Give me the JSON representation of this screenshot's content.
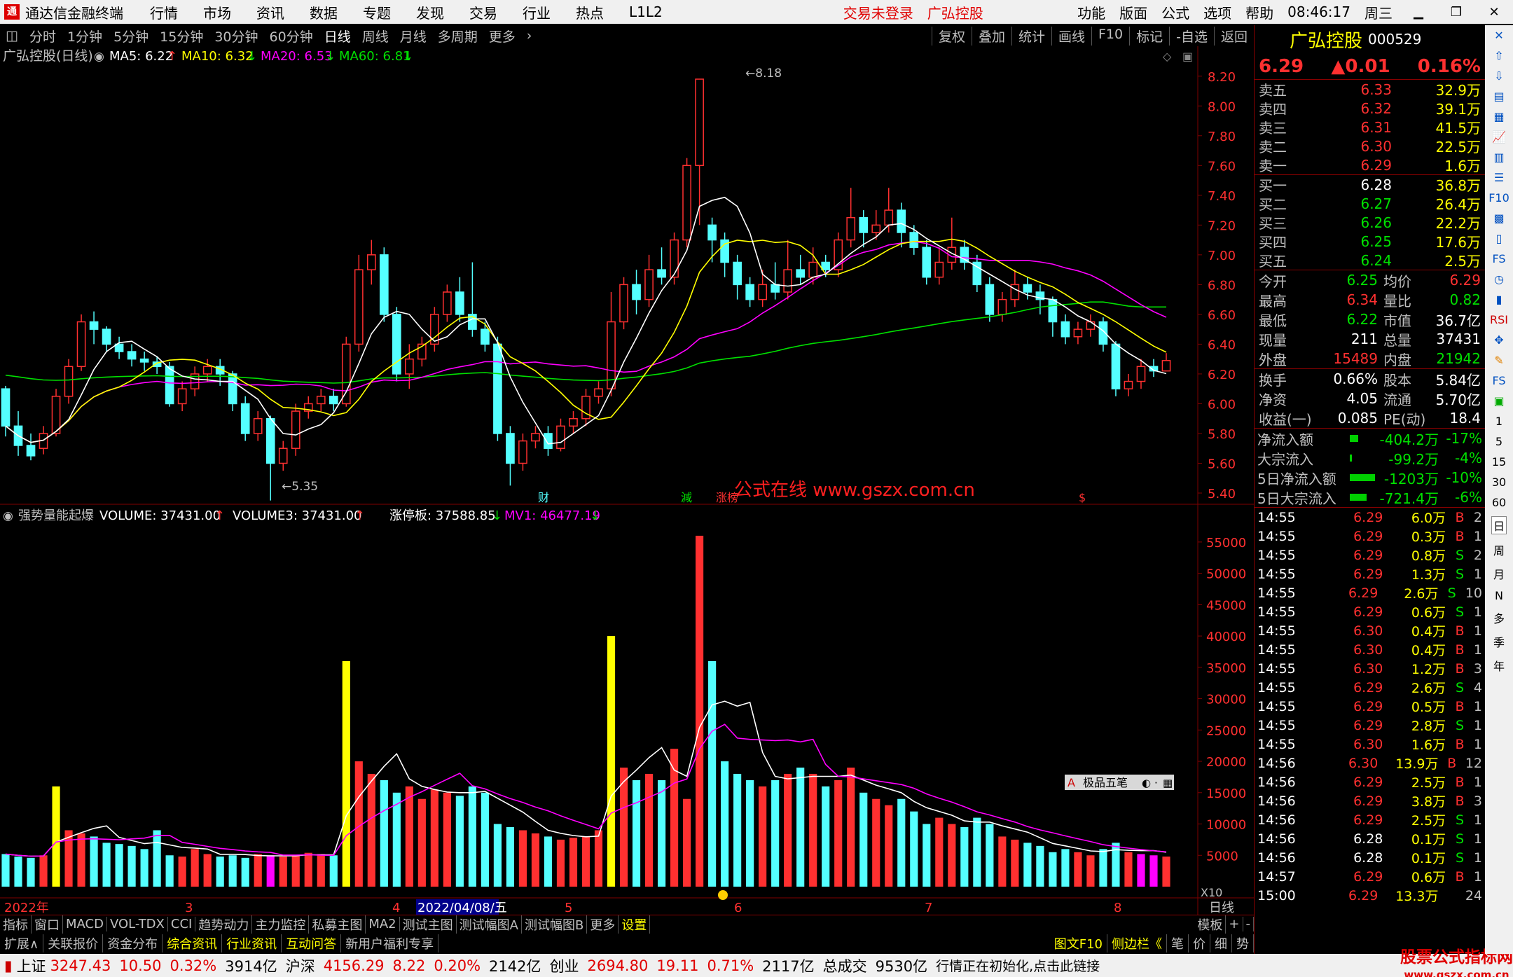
{
  "menubar": {
    "app_title": "通达信金融终端",
    "items": [
      "行情",
      "市场",
      "资讯",
      "数据",
      "专题",
      "发现",
      "交易",
      "行业",
      "热点",
      "L1L2"
    ],
    "login_status": "交易未登录",
    "stock_short": "广弘控股",
    "right_items": [
      "功能",
      "版面",
      "公式",
      "选项",
      "帮助"
    ],
    "clock": "08:46:17",
    "weekday": "周三"
  },
  "periodbar": {
    "periods": [
      "分时",
      "1分钟",
      "5分钟",
      "15分钟",
      "30分钟",
      "60分钟",
      "日线",
      "周线",
      "月线",
      "多周期",
      "更多"
    ],
    "active": "日线",
    "tools": [
      "复权",
      "叠加",
      "统计",
      "画线",
      "F10",
      "标记",
      "-自选",
      "返回"
    ]
  },
  "main_chart": {
    "title": "广弘控股(日线)",
    "ma": [
      {
        "label": "MA5: 6.22",
        "arrow": "↑",
        "color": "#ffffff"
      },
      {
        "label": "MA10: 6.32",
        "arrow": "↓",
        "color": "#ffff00"
      },
      {
        "label": "MA20: 6.53",
        "arrow": "↓",
        "color": "#ff00ff"
      },
      {
        "label": "MA60: 6.81",
        "arrow": "↓",
        "color": "#00e000"
      }
    ],
    "price_ticks": [
      "8.20",
      "8.00",
      "7.80",
      "7.60",
      "7.40",
      "7.20",
      "7.00",
      "6.80",
      "6.60",
      "6.40",
      "6.20",
      "6.00",
      "5.80",
      "5.60",
      "5.40"
    ],
    "high_label": "8.18",
    "low_label": "5.35",
    "markers": [
      "财",
      "減",
      "涨榜",
      "$"
    ],
    "watermark": "公式在线 www.gszx.com.cn"
  },
  "volume_chart": {
    "indicator": "强势量能起爆",
    "legend": [
      {
        "label": "VOLUME: 37431.00",
        "arrow": "↑",
        "color": "#ffffff"
      },
      {
        "label": "VOLUME3: 37431.00",
        "arrow": "↑",
        "color": "#ffffff"
      },
      {
        "label": "涨停板: 37588.85",
        "arrow": "↓",
        "color": "#ffffff"
      },
      {
        "label": "MV1: 46477.19",
        "arrow": "↓",
        "color": "#ff00ff"
      }
    ],
    "vol_ticks": [
      "55000",
      "50000",
      "45000",
      "40000",
      "35000",
      "30000",
      "25000",
      "20000",
      "15000",
      "10000",
      "5000"
    ],
    "multiplier": "X10",
    "five_level_btn": "极品五笔"
  },
  "xaxis": {
    "labels": [
      "2022年",
      "3",
      "4",
      "5",
      "6",
      "7",
      "8"
    ],
    "cursor_date": "2022/04/08/五",
    "period": "日线"
  },
  "bottomtabs": [
    "指标",
    "窗口",
    "MACD",
    "VOL-TDX",
    "CCI",
    "趋势动力",
    "主力监控",
    "私募主图",
    "MA2",
    "测试主图",
    "测试幅图A",
    "测试幅图B",
    "更多",
    "设置"
  ],
  "bottomtabs_right": [
    "模板",
    "+",
    "-"
  ],
  "bottomtabs2": [
    "扩展∧",
    "关联报价",
    "资金分布",
    "综合资讯",
    "行业资讯",
    "互动问答",
    "新用户福利专享"
  ],
  "bottomtabs2_right": [
    "图文F10",
    "侧边栏《",
    "笔",
    "价",
    "细",
    "势"
  ],
  "statusbar": {
    "items": [
      {
        "name": "上证",
        "price": "3247.43",
        "chg": "10.50",
        "pct": "0.32%",
        "amt": "3914亿"
      },
      {
        "name": "沪深",
        "price": "4156.29",
        "chg": "8.22",
        "pct": "0.20%",
        "amt": "2142亿"
      },
      {
        "name": "创业",
        "price": "2694.80",
        "chg": "19.11",
        "pct": "0.71%",
        "amt": "2117亿"
      }
    ],
    "total_label": "总成交",
    "total_value": "9530亿",
    "message": "行情正在初始化,点击此链接",
    "brand": "股票公式指标网",
    "brand_url": "www.gszx.com.cn"
  },
  "quote": {
    "name": "广弘控股",
    "code": "000529",
    "price": "6.29",
    "change": "▲0.01",
    "pct": "0.16%",
    "asks": [
      {
        "label": "卖五",
        "price": "6.33",
        "vol": "32.9万"
      },
      {
        "label": "卖四",
        "price": "6.32",
        "vol": "39.1万"
      },
      {
        "label": "卖三",
        "price": "6.31",
        "vol": "41.5万"
      },
      {
        "label": "卖二",
        "price": "6.30",
        "vol": "22.5万"
      },
      {
        "label": "卖一",
        "price": "6.29",
        "vol": "1.6万"
      }
    ],
    "bids": [
      {
        "label": "买一",
        "price": "6.28",
        "vol": "36.8万"
      },
      {
        "label": "买二",
        "price": "6.27",
        "vol": "26.4万"
      },
      {
        "label": "买三",
        "price": "6.26",
        "vol": "22.2万"
      },
      {
        "label": "买四",
        "price": "6.25",
        "vol": "17.6万"
      },
      {
        "label": "买五",
        "price": "6.24",
        "vol": "2.5万"
      }
    ],
    "stats": [
      {
        "k": "今开",
        "v": "6.25",
        "k2": "均价",
        "v2": "6.29"
      },
      {
        "k": "最高",
        "v": "6.34",
        "k2": "量比",
        "v2": "0.82"
      },
      {
        "k": "最低",
        "v": "6.22",
        "k2": "市值",
        "v2": "36.7亿"
      },
      {
        "k": "现量",
        "v": "211",
        "k2": "总量",
        "v2": "37431"
      },
      {
        "k": "外盘",
        "v": "15489",
        "k2": "内盘",
        "v2": "21942"
      }
    ],
    "stats2": [
      {
        "k": "换手",
        "v": "0.66%",
        "k2": "股本",
        "v2": "5.84亿"
      },
      {
        "k": "净资",
        "v": "4.05",
        "k2": "流通",
        "v2": "5.70亿"
      },
      {
        "k": "收益(一)",
        "v": "0.085",
        "k2": "PE(动)",
        "v2": "18.4"
      }
    ],
    "flows": [
      {
        "k": "净流入额",
        "v": "-404.2万",
        "p": "-17%"
      },
      {
        "k": "大宗流入",
        "v": "-99.2万",
        "p": "-4%"
      },
      {
        "k": "5日净流入额",
        "v": "-1203万",
        "p": "-10%"
      },
      {
        "k": "5日大宗流入",
        "v": "-721.4万",
        "p": "-6%"
      }
    ]
  },
  "ticks": [
    {
      "t": "14:55",
      "p": "6.29",
      "v": "6.0万",
      "bs": "B",
      "n": "2"
    },
    {
      "t": "14:55",
      "p": "6.29",
      "v": "0.3万",
      "bs": "B",
      "n": "1"
    },
    {
      "t": "14:55",
      "p": "6.29",
      "v": "0.8万",
      "bs": "S",
      "n": "2"
    },
    {
      "t": "14:55",
      "p": "6.29",
      "v": "1.3万",
      "bs": "S",
      "n": "1"
    },
    {
      "t": "14:55",
      "p": "6.29",
      "v": "2.6万",
      "bs": "S",
      "n": "10"
    },
    {
      "t": "14:55",
      "p": "6.29",
      "v": "0.6万",
      "bs": "S",
      "n": "1"
    },
    {
      "t": "14:55",
      "p": "6.30",
      "v": "0.4万",
      "bs": "B",
      "n": "1"
    },
    {
      "t": "14:55",
      "p": "6.30",
      "v": "0.4万",
      "bs": "B",
      "n": "1"
    },
    {
      "t": "14:55",
      "p": "6.30",
      "v": "1.2万",
      "bs": "B",
      "n": "3"
    },
    {
      "t": "14:55",
      "p": "6.29",
      "v": "2.6万",
      "bs": "S",
      "n": "4"
    },
    {
      "t": "14:55",
      "p": "6.29",
      "v": "0.5万",
      "bs": "B",
      "n": "1"
    },
    {
      "t": "14:55",
      "p": "6.29",
      "v": "2.8万",
      "bs": "S",
      "n": "1"
    },
    {
      "t": "14:55",
      "p": "6.30",
      "v": "1.6万",
      "bs": "B",
      "n": "1"
    },
    {
      "t": "14:56",
      "p": "6.30",
      "v": "13.9万",
      "bs": "B",
      "n": "12"
    },
    {
      "t": "14:56",
      "p": "6.29",
      "v": "2.5万",
      "bs": "B",
      "n": "1"
    },
    {
      "t": "14:56",
      "p": "6.29",
      "v": "3.8万",
      "bs": "B",
      "n": "3"
    },
    {
      "t": "14:56",
      "p": "6.29",
      "v": "2.5万",
      "bs": "S",
      "n": "1"
    },
    {
      "t": "14:56",
      "p": "6.28",
      "v": "0.1万",
      "bs": "S",
      "n": "1"
    },
    {
      "t": "14:56",
      "p": "6.28",
      "v": "0.1万",
      "bs": "S",
      "n": "1"
    },
    {
      "t": "14:57",
      "p": "6.29",
      "v": "0.6万",
      "bs": "B",
      "n": "1"
    },
    {
      "t": "15:00",
      "p": "6.29",
      "v": "13.3万",
      "bs": "",
      "n": "24"
    }
  ],
  "iconcol": [
    "1",
    "5",
    "15",
    "30",
    "60",
    "日",
    "周",
    "月",
    "N",
    "多",
    "季",
    "年"
  ],
  "colors": {
    "up": "#ff3030",
    "down": "#54ffff",
    "ma5": "#ffffff",
    "ma10": "#ffff00",
    "ma20": "#ff00ff",
    "ma60": "#00e000",
    "grid": "#800000"
  },
  "chart_data": {
    "type": "candlestick",
    "ylim": [
      5.35,
      8.25
    ],
    "candles": [
      [
        6.1,
        5.85,
        6.12,
        5.78
      ],
      [
        5.85,
        5.72,
        5.95,
        5.65
      ],
      [
        5.72,
        5.65,
        5.8,
        5.62
      ],
      [
        5.7,
        5.8,
        5.85,
        5.66
      ],
      [
        5.8,
        6.05,
        6.1,
        5.78
      ],
      [
        6.05,
        6.25,
        6.3,
        6.0
      ],
      [
        6.25,
        6.55,
        6.6,
        6.22
      ],
      [
        6.55,
        6.5,
        6.62,
        6.4
      ],
      [
        6.5,
        6.4,
        6.52,
        6.35
      ],
      [
        6.4,
        6.35,
        6.45,
        6.3
      ],
      [
        6.35,
        6.3,
        6.4,
        6.25
      ],
      [
        6.3,
        6.28,
        6.35,
        6.22
      ],
      [
        6.28,
        6.25,
        6.32,
        6.2
      ],
      [
        6.25,
        6.0,
        6.28,
        5.98
      ],
      [
        6.0,
        6.1,
        6.15,
        5.95
      ],
      [
        6.1,
        6.2,
        6.25,
        6.05
      ],
      [
        6.2,
        6.25,
        6.3,
        6.15
      ],
      [
        6.25,
        6.2,
        6.3,
        6.12
      ],
      [
        6.2,
        6.0,
        6.22,
        5.95
      ],
      [
        6.0,
        5.8,
        6.05,
        5.75
      ],
      [
        5.8,
        5.9,
        5.95,
        5.75
      ],
      [
        5.9,
        5.6,
        5.92,
        5.35
      ],
      [
        5.6,
        5.7,
        5.75,
        5.55
      ],
      [
        5.7,
        5.95,
        6.0,
        5.65
      ],
      [
        5.95,
        6.0,
        6.05,
        5.9
      ],
      [
        6.0,
        6.05,
        6.1,
        5.95
      ],
      [
        6.05,
        6.0,
        6.1,
        5.95
      ],
      [
        6.0,
        6.4,
        6.45,
        5.98
      ],
      [
        6.4,
        6.9,
        7.0,
        6.35
      ],
      [
        6.9,
        7.0,
        7.1,
        6.8
      ],
      [
        7.0,
        6.6,
        7.05,
        6.55
      ],
      [
        6.6,
        6.2,
        6.65,
        6.15
      ],
      [
        6.2,
        6.3,
        6.4,
        6.1
      ],
      [
        6.3,
        6.4,
        6.45,
        6.25
      ],
      [
        6.4,
        6.6,
        6.65,
        6.35
      ],
      [
        6.6,
        6.75,
        6.8,
        6.55
      ],
      [
        6.75,
        6.6,
        6.85,
        6.55
      ],
      [
        6.6,
        6.5,
        6.95,
        6.45
      ],
      [
        6.5,
        6.4,
        6.55,
        6.35
      ],
      [
        6.4,
        5.8,
        6.45,
        5.75
      ],
      [
        5.8,
        5.6,
        5.85,
        5.45
      ],
      [
        5.6,
        5.75,
        5.8,
        5.55
      ],
      [
        5.75,
        5.8,
        5.85,
        5.7
      ],
      [
        5.8,
        5.7,
        5.85,
        5.65
      ],
      [
        5.7,
        5.85,
        5.9,
        5.68
      ],
      [
        5.85,
        5.9,
        5.95,
        5.8
      ],
      [
        5.9,
        6.05,
        6.1,
        5.85
      ],
      [
        6.05,
        6.1,
        6.15,
        6.0
      ],
      [
        6.1,
        6.55,
        6.75,
        6.05
      ],
      [
        6.55,
        6.8,
        6.85,
        6.5
      ],
      [
        6.8,
        6.7,
        6.9,
        6.6
      ],
      [
        6.7,
        6.9,
        7.0,
        6.65
      ],
      [
        6.9,
        6.85,
        7.05,
        6.8
      ],
      [
        6.85,
        7.1,
        7.15,
        6.8
      ],
      [
        7.1,
        7.6,
        7.65,
        7.05
      ],
      [
        7.6,
        8.18,
        8.18,
        7.2
      ],
      [
        7.2,
        7.1,
        7.25,
        6.95
      ],
      [
        7.1,
        6.95,
        7.15,
        6.85
      ],
      [
        6.95,
        6.8,
        7.0,
        6.7
      ],
      [
        6.8,
        6.7,
        6.85,
        6.65
      ],
      [
        6.7,
        6.8,
        6.9,
        6.65
      ],
      [
        6.8,
        6.75,
        6.95,
        6.7
      ],
      [
        6.75,
        6.9,
        7.1,
        6.7
      ],
      [
        6.9,
        6.85,
        7.0,
        6.8
      ],
      [
        6.85,
        6.95,
        7.05,
        6.8
      ],
      [
        6.95,
        6.9,
        7.0,
        6.85
      ],
      [
        6.9,
        7.1,
        7.15,
        6.85
      ],
      [
        7.1,
        7.25,
        7.45,
        7.05
      ],
      [
        7.25,
        7.15,
        7.3,
        7.05
      ],
      [
        7.15,
        7.2,
        7.3,
        7.1
      ],
      [
        7.2,
        7.3,
        7.45,
        7.15
      ],
      [
        7.3,
        7.15,
        7.35,
        7.05
      ],
      [
        7.15,
        7.05,
        7.2,
        7.0
      ],
      [
        7.05,
        6.85,
        7.1,
        6.8
      ],
      [
        6.85,
        6.95,
        7.05,
        6.8
      ],
      [
        6.95,
        7.05,
        7.25,
        6.9
      ],
      [
        7.05,
        6.95,
        7.1,
        6.9
      ],
      [
        6.95,
        6.8,
        7.0,
        6.75
      ],
      [
        6.8,
        6.6,
        6.85,
        6.55
      ],
      [
        6.6,
        6.7,
        6.75,
        6.55
      ],
      [
        6.7,
        6.8,
        6.9,
        6.65
      ],
      [
        6.8,
        6.75,
        6.85,
        6.7
      ],
      [
        6.75,
        6.7,
        6.8,
        6.6
      ],
      [
        6.7,
        6.55,
        6.72,
        6.45
      ],
      [
        6.55,
        6.45,
        6.6,
        6.4
      ],
      [
        6.45,
        6.5,
        6.55,
        6.4
      ],
      [
        6.5,
        6.55,
        6.6,
        6.45
      ],
      [
        6.55,
        6.4,
        6.58,
        6.35
      ],
      [
        6.4,
        6.1,
        6.42,
        6.05
      ],
      [
        6.1,
        6.15,
        6.2,
        6.05
      ],
      [
        6.15,
        6.25,
        6.3,
        6.1
      ],
      [
        6.25,
        6.22,
        6.3,
        6.18
      ],
      [
        6.22,
        6.29,
        6.34,
        6.22
      ]
    ],
    "volumes": [
      5200,
      4800,
      4600,
      5000,
      16000,
      9000,
      8500,
      8000,
      7000,
      6800,
      6500,
      6000,
      9000,
      5000,
      4800,
      6000,
      5200,
      4800,
      5000,
      4600,
      5200,
      5000,
      4800,
      5000,
      5400,
      5200,
      5000,
      36000,
      20000,
      18000,
      17000,
      15000,
      16000,
      14000,
      15500,
      15000,
      14500,
      16000,
      15000,
      10000,
      9500,
      9000,
      8500,
      8000,
      7500,
      7800,
      8000,
      9000,
      40000,
      19000,
      17000,
      18000,
      17000,
      22000,
      14000,
      56000,
      36000,
      20000,
      18000,
      17000,
      16000,
      17000,
      18000,
      19000,
      18000,
      16000,
      17000,
      19000,
      15000,
      14000,
      13000,
      14000,
      12000,
      10000,
      11000,
      10000,
      9500,
      11000,
      10000,
      8000,
      7500,
      7000,
      6500,
      5500,
      6000,
      5500,
      5000,
      6000,
      7000,
      5500,
      5200,
      5000,
      4800
    ],
    "vol_ylim": [
      0,
      57000
    ]
  }
}
